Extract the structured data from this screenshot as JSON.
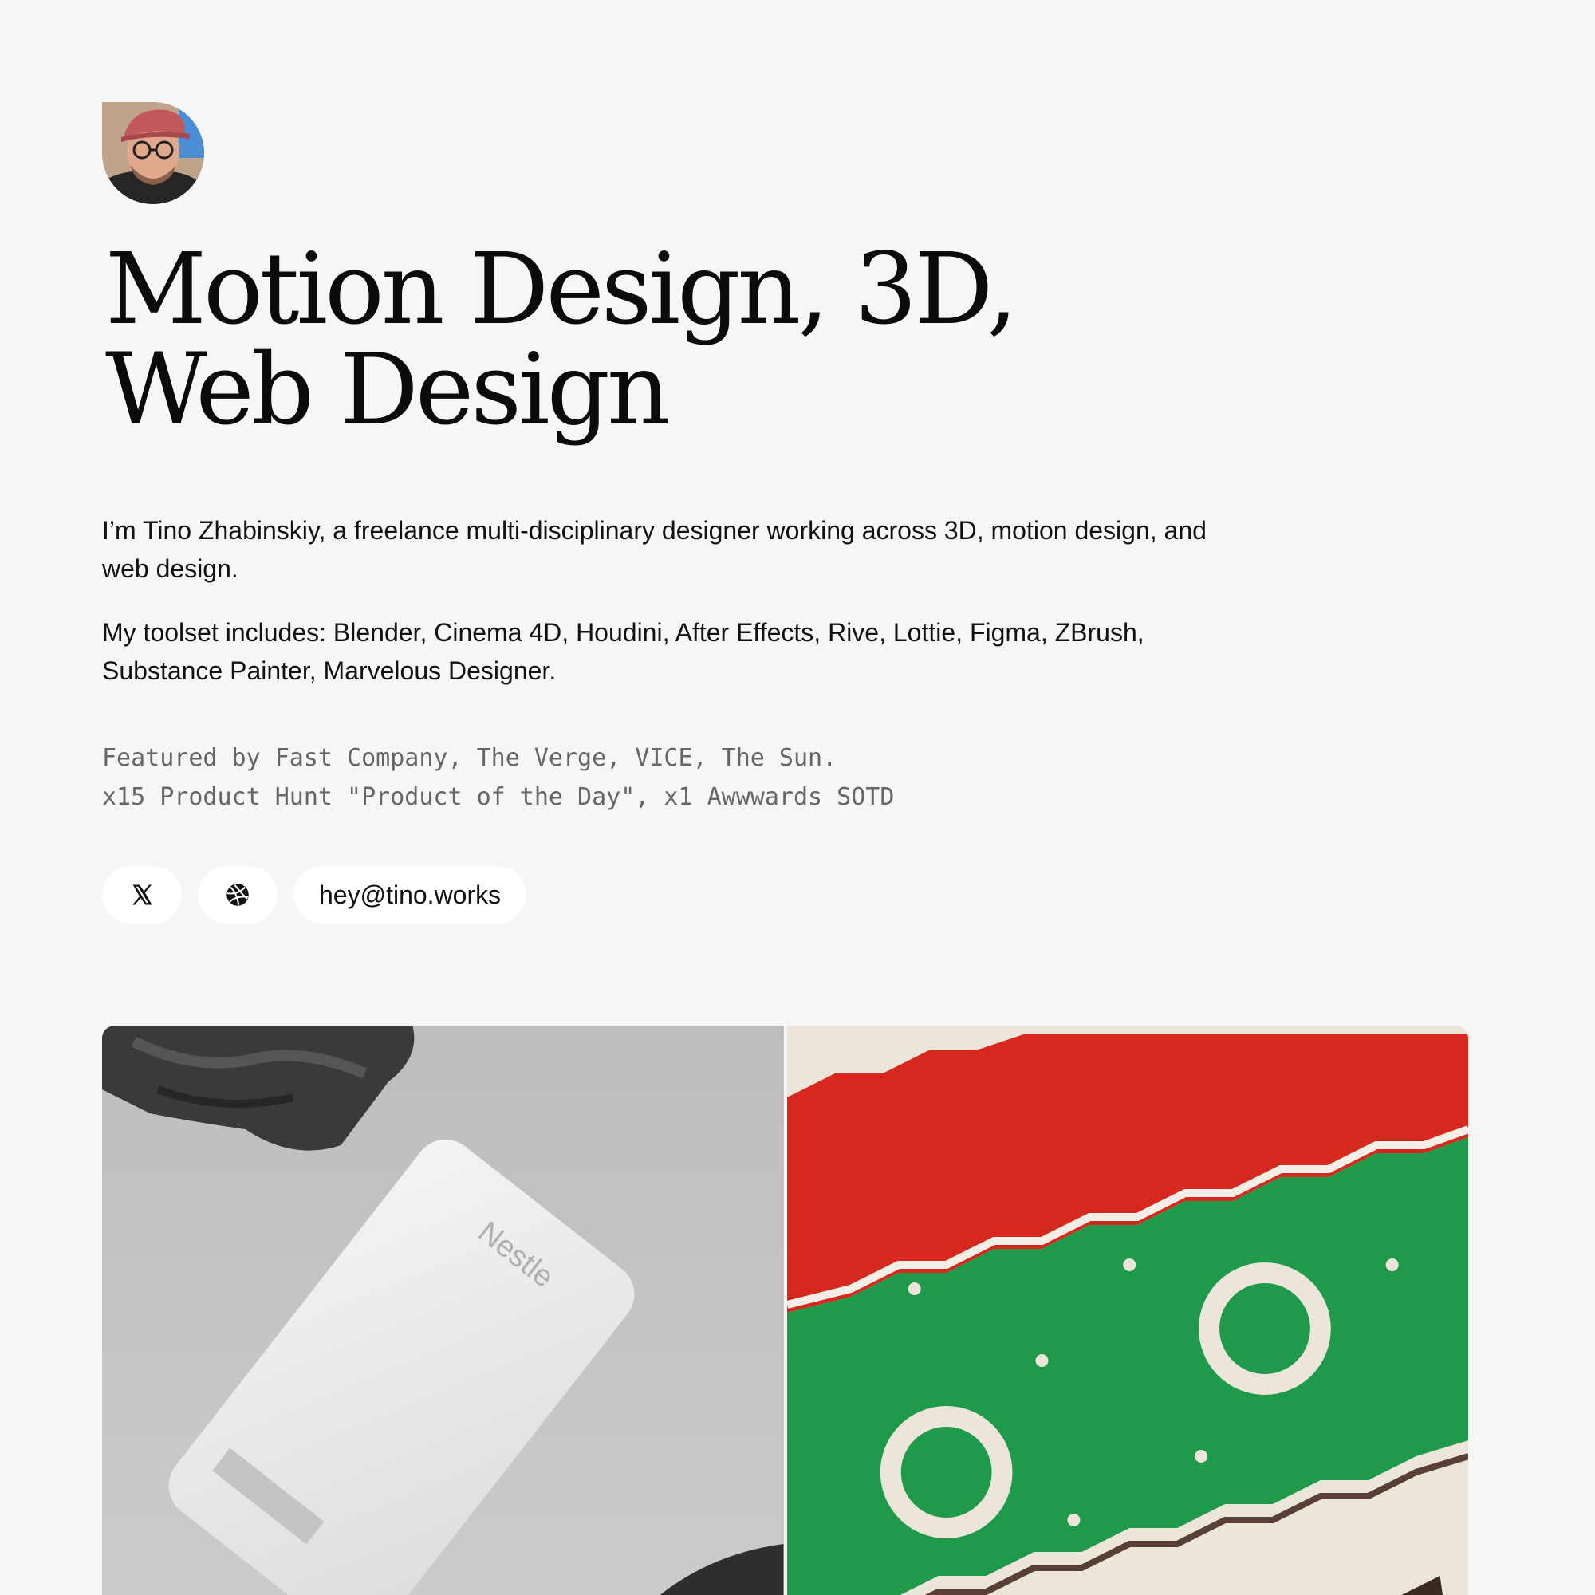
{
  "profile": {
    "avatar_alt": "Tino Zhabinskiy avatar"
  },
  "headline": "Motion Design, 3D, Web Design",
  "bio": {
    "intro": "I’m Tino Zhabinskiy, a freelance multi-disciplinary designer working across 3D, motion design, and web design.",
    "toolset": "My toolset includes: Blender, Cinema 4D, Houdini, After Effects, Rive, Lottie, Figma, ZBrush, Substance Painter, Marvelous Designer."
  },
  "featured": {
    "line1": "Featured by Fast Company, The Verge, VICE, The Sun.",
    "line2": "x15 Product Hunt \"Product of the Day\", x1 Awwwards SOTD"
  },
  "links": {
    "x_icon": "x-logo-icon",
    "dribbble_icon": "dribbble-icon",
    "email": "hey@tino.works"
  },
  "gallery": {
    "tiles": [
      {
        "name": "nestle-card-project",
        "card_brand": "Nestle"
      },
      {
        "name": "github-sweater-project"
      }
    ]
  },
  "colors": {
    "background": "#f6f6f6",
    "text": "#111111",
    "muted_text": "#666666",
    "pill_bg": "#ffffff",
    "sweater_red": "#d6281f",
    "sweater_green": "#1f9a4a",
    "sweater_cream": "#ece6da"
  }
}
